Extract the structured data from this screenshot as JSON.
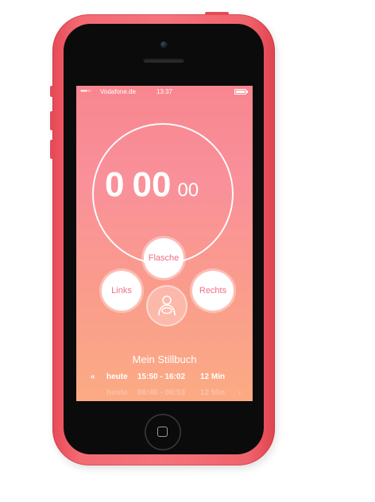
{
  "status_bar": {
    "signal": "●●●○○",
    "carrier": "Vodafone.de",
    "time": "13:37"
  },
  "timer": {
    "minutes": "0",
    "seconds": "00",
    "hundredths": "00"
  },
  "buttons": {
    "bottle": "Flasche",
    "left": "Links",
    "right": "Rechts"
  },
  "icons": {
    "baby": "nursing-baby-icon",
    "home": "home-button-icon",
    "prev": "chevron-left-icon",
    "next": "chevron-right-icon"
  },
  "log": {
    "title": "Mein Stillbuch",
    "prev": "«",
    "next": "›",
    "entries": [
      {
        "day": "heute",
        "range": "15:50 - 16:02",
        "duration": "12 Min"
      },
      {
        "day": "heute",
        "range": "06:40 - 06:53",
        "duration": "12 Min"
      }
    ]
  },
  "colors": {
    "phone_case": "#f36a73",
    "screen_top": "#f8868f",
    "screen_bottom": "#fbab84",
    "button_text": "#ef6e86"
  }
}
